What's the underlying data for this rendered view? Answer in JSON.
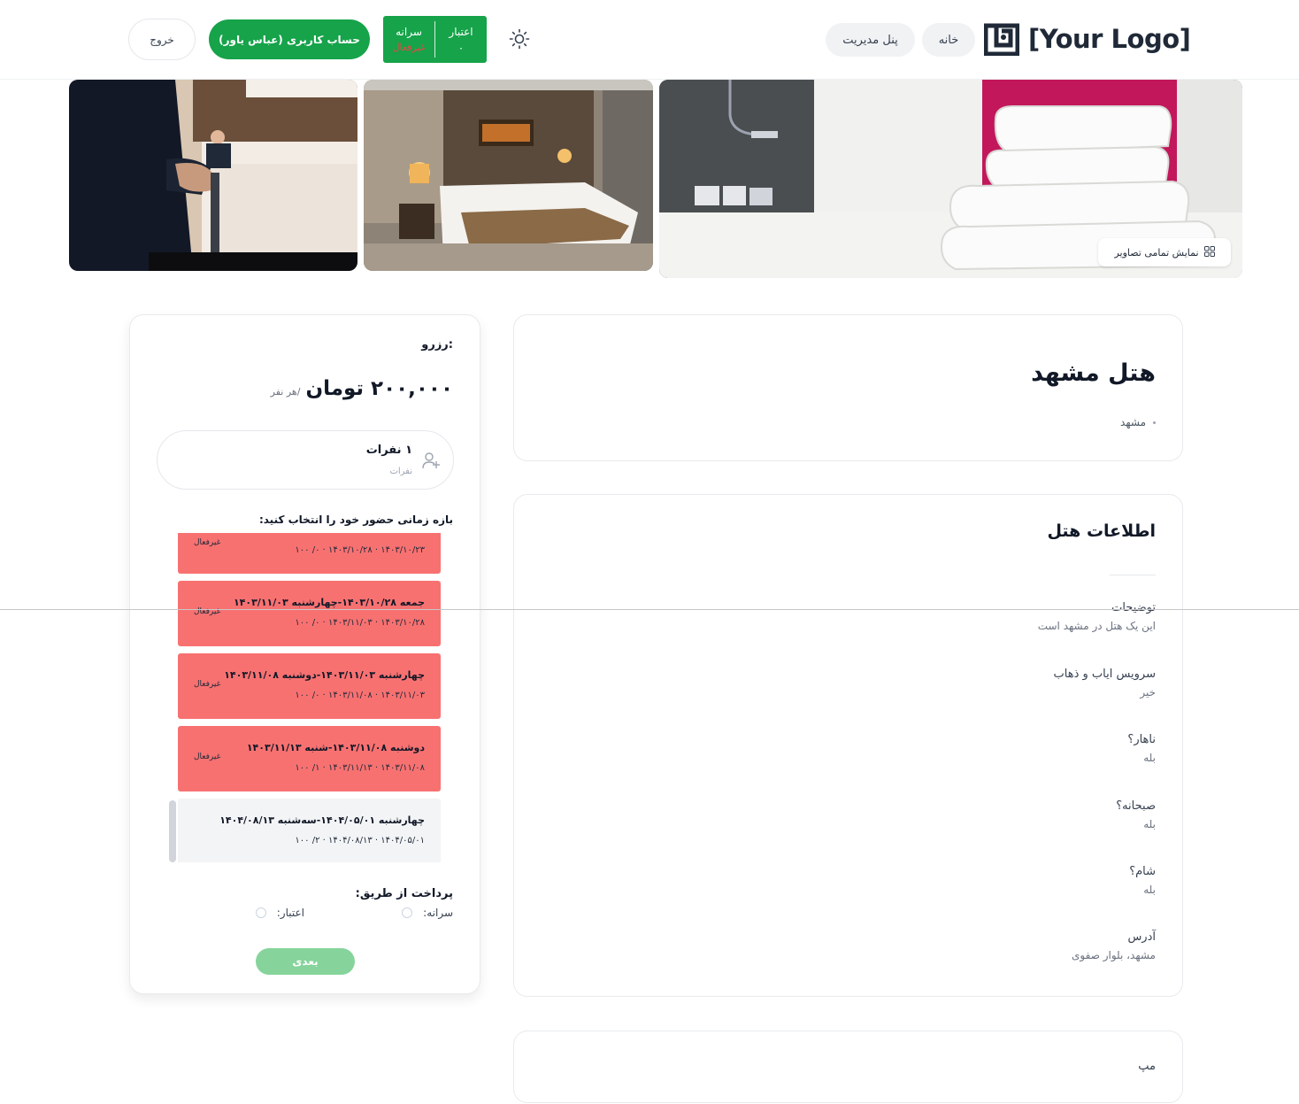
{
  "header": {
    "logo_text": "[Your Logo]",
    "nav_home": "خانه",
    "nav_admin": "پنل مدیریت",
    "credit": {
      "credit_label": "اعتبار",
      "credit_value": "۰",
      "quota_label": "سرانه",
      "quota_value": "غیرفعال"
    },
    "account_label": "حساب کاربری (عباس یاور)",
    "logout_label": "خروج",
    "theme_icon": "sun-icon"
  },
  "gallery": {
    "show_all_label": "نمایش تمامی تصاویر",
    "images": [
      "towels-on-bed",
      "hotel-bedroom",
      "reception-with-luggage"
    ]
  },
  "hotel": {
    "name": "هتل مشهد",
    "city": "مشهد"
  },
  "hotel_info": {
    "title": "اطلاعات هتل",
    "items": [
      {
        "label": "توضیحات",
        "value": "این یک هتل در مشهد است"
      },
      {
        "label": "سرویس ایاب و ذهاب",
        "value": "خیر"
      },
      {
        "label": "ناهار؟",
        "value": "بله"
      },
      {
        "label": "صبحانه؟",
        "value": "بله"
      },
      {
        "label": "شام؟",
        "value": "بله"
      },
      {
        "label": "آدرس",
        "value": "مشهد، بلوار صفوی"
      }
    ]
  },
  "map": {
    "title": "مپ"
  },
  "booking": {
    "label": "رزرو:",
    "price": "۲۰۰,۰۰۰ تومان",
    "per_person": "/هر نفر",
    "people_main": "۱ نفرات",
    "people_sub": "نفرات",
    "range_label": "بازه زمانی حضور خود را انتخاب کنید:",
    "slots": [
      {
        "title": "",
        "sub": "۱۴۰۳/۱۰/۲۳ · ۱۴۰۳/۱۰/۲۸ · ۰/ ۱۰۰",
        "status": "غیرفعال",
        "active": false
      },
      {
        "title": "جمعه ۱۴۰۳/۱۰/۲۸-چهارشنبه ۱۴۰۳/۱۱/۰۳",
        "sub": "۱۴۰۳/۱۰/۲۸ · ۱۴۰۳/۱۱/۰۳ · ۰/ ۱۰۰",
        "status": "غیرفعال",
        "active": false
      },
      {
        "title": "چهارشنبه ۱۴۰۳/۱۱/۰۳-دوشنبه ۱۴۰۳/۱۱/۰۸",
        "sub": "۱۴۰۳/۱۱/۰۳ · ۱۴۰۳/۱۱/۰۸ · ۰/ ۱۰۰",
        "status": "غیرفعال",
        "active": false
      },
      {
        "title": "دوشنبه ۱۴۰۳/۱۱/۰۸-شنبه ۱۴۰۳/۱۱/۱۳",
        "sub": "۱۴۰۳/۱۱/۰۸ · ۱۴۰۳/۱۱/۱۳ · ۱/ ۱۰۰",
        "status": "غیرفعال",
        "active": false
      },
      {
        "title": "چهارشنبه ۱۴۰۴/۰۵/۰۱-سه‌شنبه ۱۴۰۴/۰۸/۱۳",
        "sub": "۱۴۰۴/۰۵/۰۱ · ۱۴۰۴/۰۸/۱۳ · ۲/ ۱۰۰",
        "status": "",
        "active": true
      }
    ],
    "pay_label": "پرداخت از طریق:",
    "pay_quota": "سرانه:",
    "pay_credit": "اعتبار:",
    "next_label": "بعدی"
  },
  "colors": {
    "brand_green": "#16a34a",
    "inactive_red": "#f87171",
    "next_disabled": "#86d49b"
  }
}
